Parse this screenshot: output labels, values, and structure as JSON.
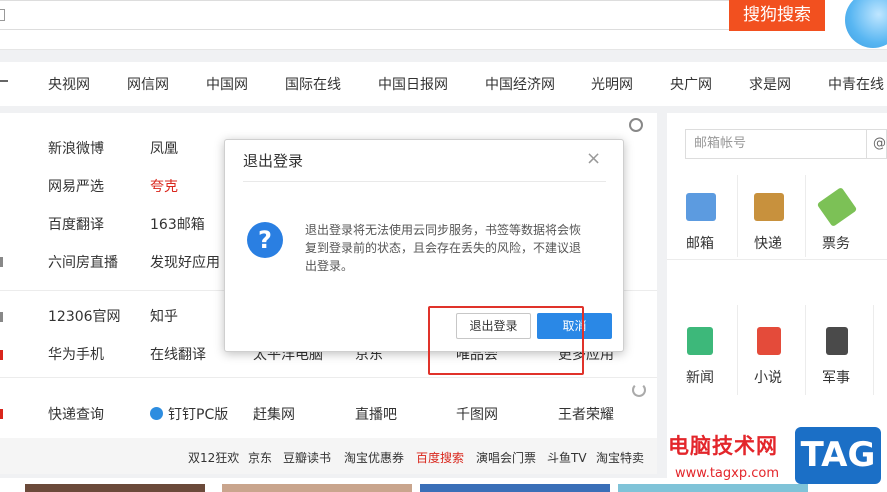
{
  "search": {
    "button_label": "搜狗搜索"
  },
  "nav": [
    "央视网",
    "网信网",
    "中国网",
    "国际在线",
    "中国日报网",
    "中国经济网",
    "光明网",
    "央广网",
    "求是网",
    "中青在线"
  ],
  "links": {
    "row1": [
      "新浪微博",
      "凤凰"
    ],
    "row2": [
      "网易严选",
      "夸克"
    ],
    "row3": [
      "百度翻译",
      "163邮箱"
    ],
    "row4": [
      "六间房直播",
      "发现好应用"
    ],
    "row5": [
      "12306官网",
      "知乎"
    ],
    "row6": [
      "华为手机",
      "在线翻译",
      "太平洋电脑",
      "京东",
      "唯品会",
      "更多应用"
    ],
    "row7": [
      "快递查询",
      "钉钉PC版",
      "赶集网",
      "直播吧",
      "千图网",
      "王者荣耀"
    ]
  },
  "bottom_links": [
    "双12狂欢",
    "京东",
    "豆瓣读书",
    "淘宝优惠券",
    "百度搜索",
    "演唱会门票",
    "斗鱼TV",
    "淘宝特卖"
  ],
  "email": {
    "placeholder": "邮箱帐号",
    "suffix": "@"
  },
  "services": [
    "邮箱",
    "快递",
    "票务",
    "新闻",
    "小说",
    "军事"
  ],
  "dialog": {
    "title": "退出登录",
    "close": "×",
    "icon": "?",
    "message": "退出登录将无法使用云同步服务，书签等数据将会恢复到登录前的状态，且会存在丢失的风险，不建议退出登录。",
    "logout_button": "退出登录",
    "cancel_button": "取消"
  },
  "watermark": {
    "title": "电脑技术网",
    "url": "www.tagxp.com",
    "logo": "TAG"
  },
  "colors": {
    "accent_orange": "#f2501f",
    "dialog_blue": "#2a88e6",
    "highlight_red": "#e0322a"
  }
}
